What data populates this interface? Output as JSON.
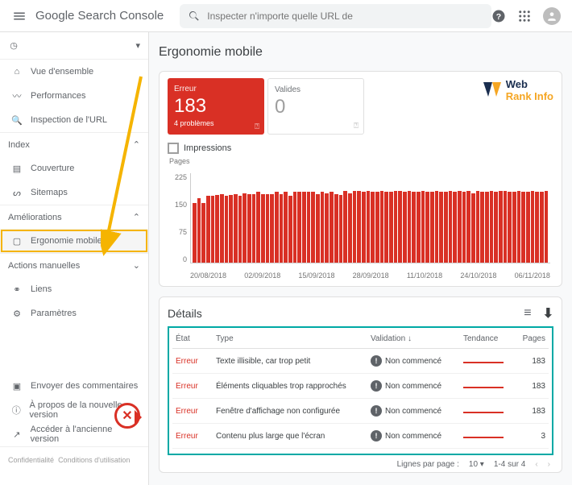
{
  "header": {
    "logo_bold": "Google",
    "logo_rest": " Search Console",
    "search_placeholder": "Inspecter n'importe quelle URL de"
  },
  "sidebar": {
    "overview": "Vue d'ensemble",
    "performance": "Performances",
    "url_inspect": "Inspection de l'URL",
    "section_index": "Index",
    "coverage": "Couverture",
    "sitemaps": "Sitemaps",
    "section_enh": "Améliorations",
    "mobile": "Ergonomie mobile",
    "section_manual": "Actions manuelles",
    "links": "Liens",
    "settings": "Paramètres",
    "feedback": "Envoyer des commentaires",
    "about": "À propos de la nouvelle version",
    "old": "Accéder à l'ancienne version",
    "conf": "Confidentialité",
    "cond": "Conditions d'utilisation"
  },
  "page": {
    "title": "Ergonomie mobile"
  },
  "summary": {
    "error_label": "Erreur",
    "error_count": "183",
    "error_sub": "4 problèmes",
    "valid_label": "Valides",
    "valid_count": "0",
    "impressions": "Impressions",
    "brand1": "Web",
    "brand2": "Rank Info"
  },
  "chart_data": {
    "type": "bar",
    "ylabel": "Pages",
    "ylim": [
      0,
      225
    ],
    "yticks": [
      "225",
      "150",
      "75",
      "0"
    ],
    "xticks": [
      "20/08/2018",
      "02/09/2018",
      "15/09/2018",
      "28/09/2018",
      "11/10/2018",
      "24/10/2018",
      "06/11/2018"
    ],
    "values": [
      150,
      162,
      150,
      168,
      168,
      170,
      172,
      168,
      170,
      172,
      168,
      175,
      172,
      172,
      178,
      172,
      172,
      172,
      178,
      172,
      178,
      168,
      178,
      178,
      178,
      178,
      178,
      172,
      178,
      175,
      178,
      172,
      170,
      180,
      175,
      180,
      180,
      178,
      180,
      178,
      178,
      180,
      178,
      178,
      180,
      180,
      178,
      180,
      178,
      178,
      180,
      178,
      178,
      180,
      178,
      178,
      180,
      178,
      180,
      178,
      180,
      175,
      180,
      178,
      178,
      180,
      178,
      180,
      180,
      178,
      178,
      180,
      178,
      178,
      180,
      178,
      178,
      180
    ]
  },
  "details": {
    "title": "Détails",
    "cols": {
      "etat": "État",
      "type": "Type",
      "validation": "Validation ↓",
      "tendance": "Tendance",
      "pages": "Pages"
    },
    "rows": [
      {
        "etat": "Erreur",
        "type": "Texte illisible, car trop petit",
        "validation": "Non commencé",
        "pages": "183"
      },
      {
        "etat": "Erreur",
        "type": "Éléments cliquables trop rapprochés",
        "validation": "Non commencé",
        "pages": "183"
      },
      {
        "etat": "Erreur",
        "type": "Fenêtre d'affichage non configurée",
        "validation": "Non commencé",
        "pages": "183"
      },
      {
        "etat": "Erreur",
        "type": "Contenu plus large que l'écran",
        "validation": "Non commencé",
        "pages": "3"
      }
    ],
    "pager": {
      "rpp_label": "Lignes par page :",
      "rpp_val": "10",
      "range": "1-4 sur 4"
    }
  }
}
